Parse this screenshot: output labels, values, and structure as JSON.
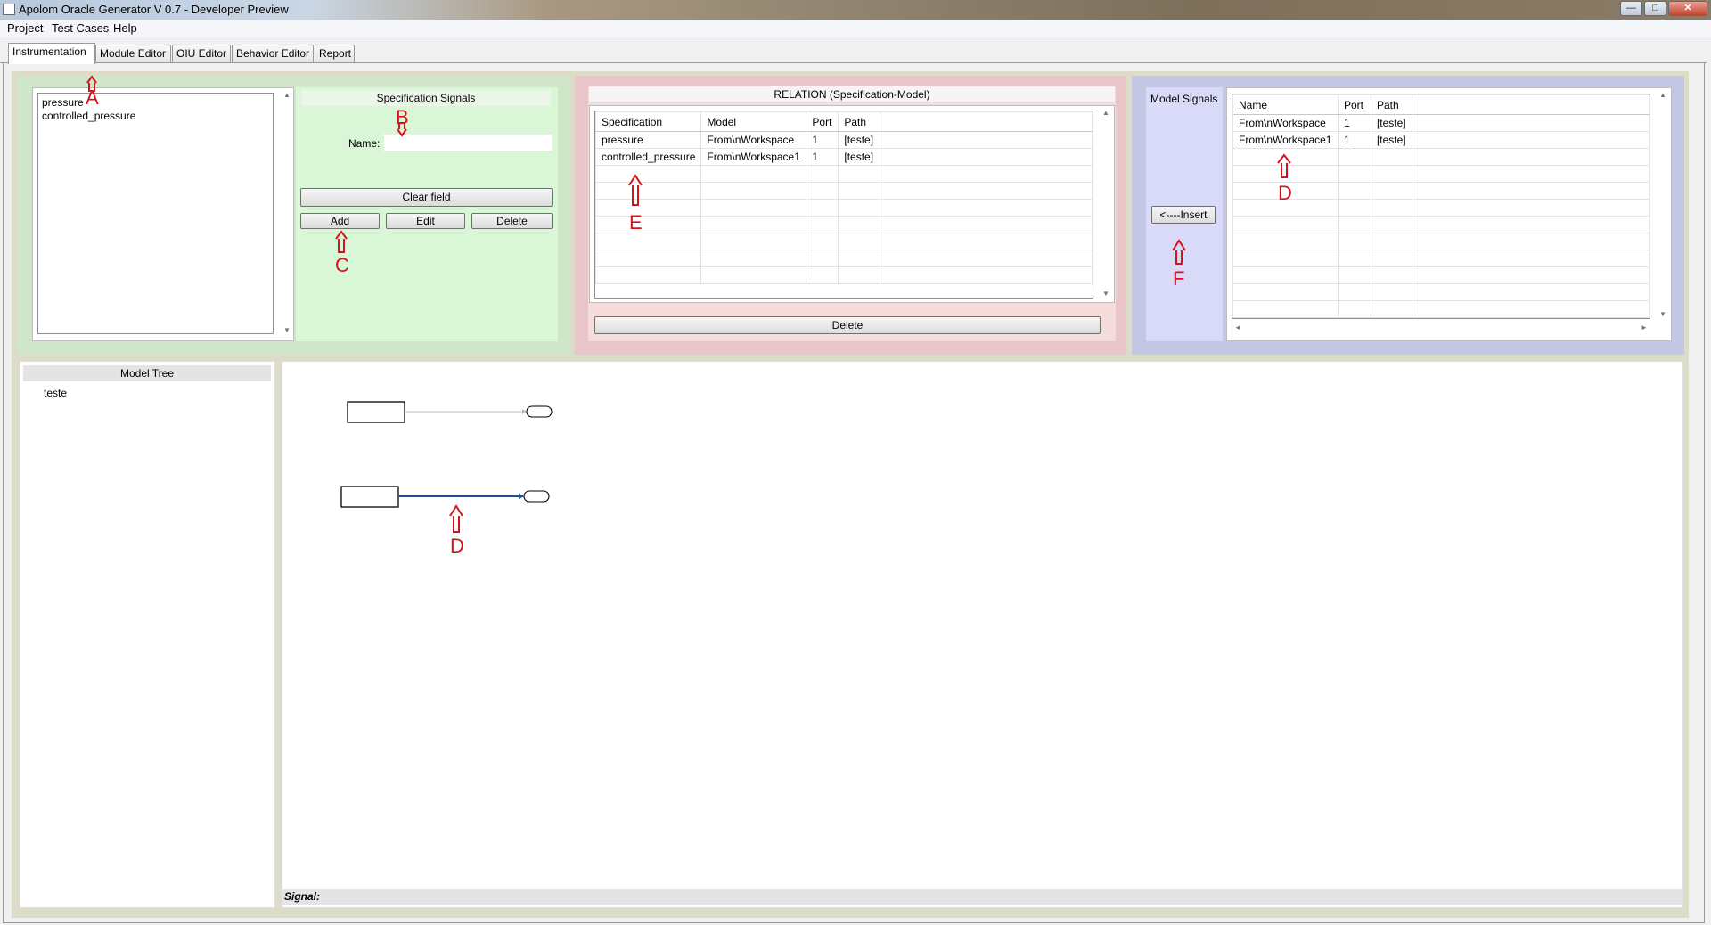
{
  "window": {
    "title": "Apolom Oracle Generator V 0.7 - Developer Preview",
    "min": "—",
    "max": "□",
    "close": "✕"
  },
  "menu": [
    "Project",
    "Test Cases",
    "Help"
  ],
  "tabs": [
    "Instrumentation",
    "Module Editor",
    "OIU Editor",
    "Behavior Editor",
    "Report"
  ],
  "spec_list": [
    "pressure",
    "controlled_pressure"
  ],
  "spec_panel": {
    "title": "Specification Signals",
    "name_label": "Name:",
    "name_value": "",
    "clear_label": "Clear field",
    "add_label": "Add",
    "edit_label": "Edit",
    "delete_label": "Delete"
  },
  "relation": {
    "title": "RELATION (Specification-Model)",
    "columns": [
      "Specification",
      "Model",
      "Port",
      "Path"
    ],
    "rows": [
      [
        "pressure",
        "From\\nWorkspace",
        "1",
        "[teste]"
      ],
      [
        "controlled_pressure",
        "From\\nWorkspace1",
        "1",
        "[teste]"
      ]
    ],
    "delete_label": "Delete"
  },
  "model_signals": {
    "title": "Model Signals",
    "insert_label": "<----Insert",
    "columns": [
      "Name",
      "Port",
      "Path"
    ],
    "rows": [
      [
        "From\\nWorkspace",
        "1",
        "[teste]"
      ],
      [
        "From\\nWorkspace1",
        "1",
        "[teste]"
      ]
    ]
  },
  "model_tree": {
    "title": "Model Tree",
    "items": [
      "teste"
    ]
  },
  "signal_label": "Signal:",
  "annotations": {
    "A": "A",
    "B": "B",
    "C": "C",
    "D1": "D",
    "D2": "D",
    "E": "E",
    "F": "F"
  },
  "colors": {
    "annotation": "#d4141c",
    "green_panel": "#d9f7d7",
    "red_panel": "#e8c5c8",
    "blue_panel": "#c4c7e4",
    "selected_line": "#1f4e8c"
  }
}
